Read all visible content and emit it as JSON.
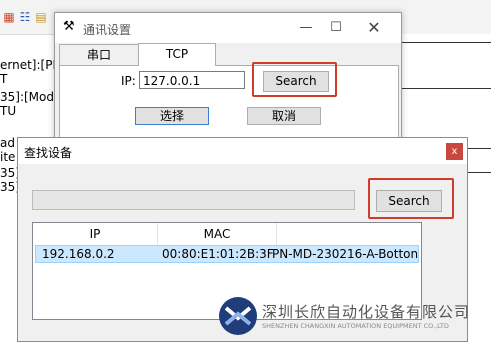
{
  "background": {
    "lines": [
      "ernet]:[PRO",
      "T",
      "35]:[Modb",
      "TU",
      "ad",
      "ite",
      "35]",
      "35]"
    ]
  },
  "comm_dialog": {
    "title": "通讯设置",
    "tabs": [
      {
        "label": "串口"
      },
      {
        "label": "TCP"
      }
    ],
    "ip_label": "IP:",
    "ip_value": "127.0.0.1",
    "search_label": "Search",
    "select_label": "选择",
    "cancel_label": "取消"
  },
  "find_dialog": {
    "title": "查找设备",
    "close_label": "x",
    "search_label": "Search",
    "progress": 0,
    "columns": [
      "IP",
      "MAC"
    ],
    "rows": [
      {
        "ip": "192.168.0.2",
        "mac": "00:80:E1:01:2B:3F",
        "name": "PN-MD-230216-A-Botton"
      }
    ]
  },
  "watermark": {
    "company": "深圳长欣自动化设备有限公司",
    "company_en": "SHENZHEN CHANGXIN AUTOMATION EQUIPMENT CO.,LTD"
  },
  "colors": {
    "highlight": "#d23a2b",
    "selection": "#cce8ff",
    "watermark_blue": "#1f3d7a"
  }
}
